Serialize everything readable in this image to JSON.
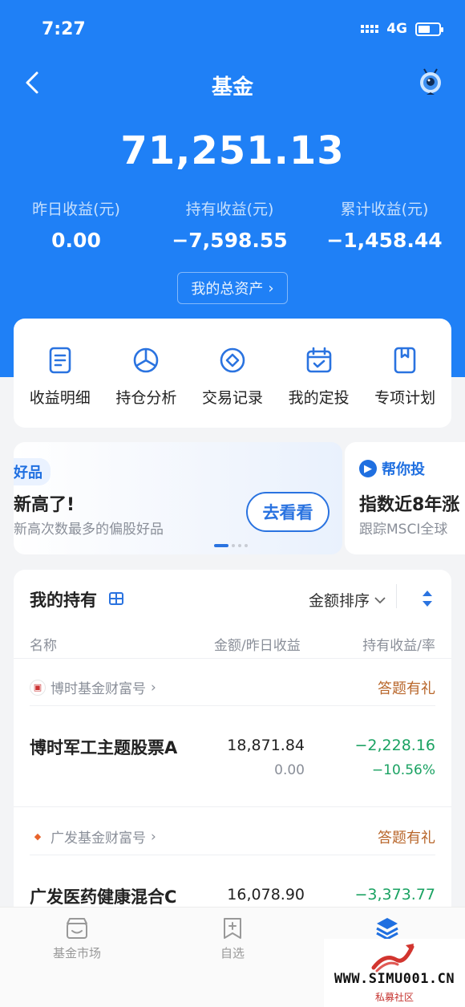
{
  "status": {
    "time": "7:27",
    "network": "4G"
  },
  "nav": {
    "title": "基金"
  },
  "summary": {
    "total": "71,251.13",
    "stats": [
      {
        "label": "昨日收益(元)",
        "value": "0.00"
      },
      {
        "label": "持有收益(元)",
        "value": "−7,598.55"
      },
      {
        "label": "累计收益(元)",
        "value": "−1,458.44"
      }
    ],
    "assets_label": "我的总资产",
    "assets_chevron": "›"
  },
  "shortcuts": [
    {
      "label": "收益明细",
      "icon": "document-icon"
    },
    {
      "label": "持仓分析",
      "icon": "pie-chart-icon"
    },
    {
      "label": "交易记录",
      "icon": "diamond-circle-icon"
    },
    {
      "label": "我的定投",
      "icon": "calendar-check-icon"
    },
    {
      "label": "专项计划",
      "icon": "bookmark-icon"
    }
  ],
  "banner": {
    "tag": "好品",
    "title": "新高了!",
    "subtitle": "新高次数最多的偏股好品",
    "button": "去看看"
  },
  "banner2": {
    "tag": "帮你投",
    "title": "指数近8年涨",
    "subtitle": "跟踪MSCI全球"
  },
  "holdings": {
    "title": "我的持有",
    "sort_label": "金额排序",
    "columns": {
      "name": "名称",
      "amount": "金额/昨日收益",
      "profit": "持有收益/率"
    },
    "groups": [
      {
        "company": "博时基金财富号",
        "promo": "答题有礼",
        "fund": {
          "name": "博时军工主题股票A",
          "amount": "18,871.84",
          "day_profit": "0.00",
          "hold_profit": "−2,228.16",
          "hold_rate": "−10.56%"
        }
      },
      {
        "company": "广发基金财富号",
        "promo": "答题有礼",
        "fund": {
          "name": "广发医药健康混合C",
          "amount": "16,078.90",
          "day_profit": "",
          "hold_profit": "−3,373.77",
          "hold_rate": ""
        }
      }
    ]
  },
  "tabbar": [
    {
      "label": "基金市场",
      "icon": "market-icon"
    },
    {
      "label": "自选",
      "icon": "add-square-icon"
    },
    {
      "label": "",
      "icon": "layers-icon"
    }
  ],
  "watermark": {
    "text": "WWW.SIMU001.CN",
    "sub": "私募社区"
  },
  "colors": {
    "brand_blue": "#1f80f6",
    "gain_green": "#1aa262",
    "promo_brown": "#b8662a"
  }
}
